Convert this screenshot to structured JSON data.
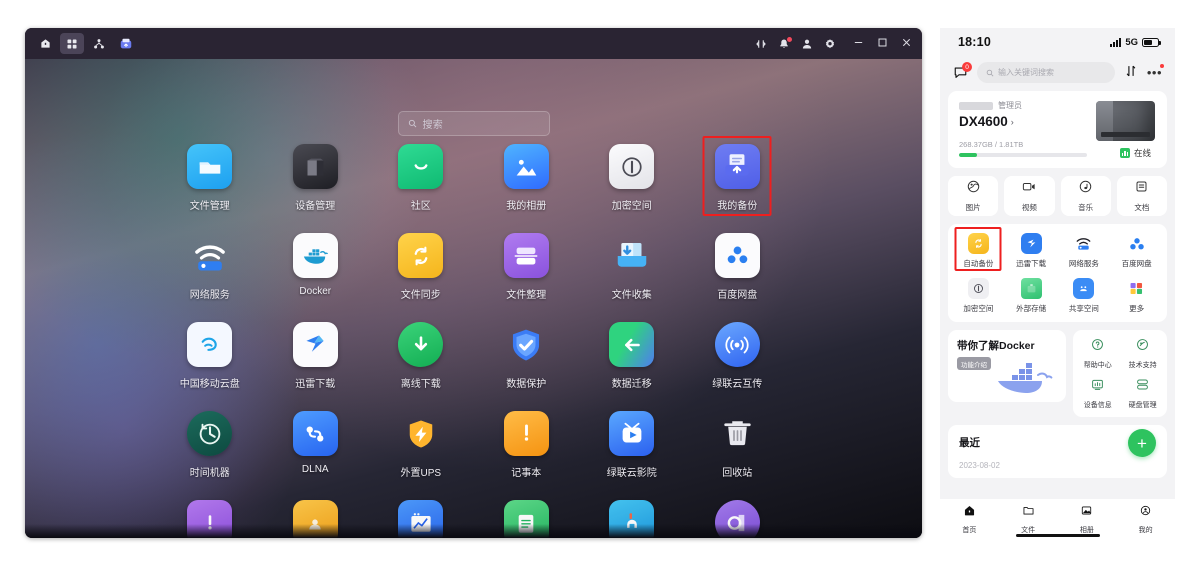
{
  "desktop": {
    "titlebar": {
      "left_icons": [
        "home-icon",
        "apps-grid-icon",
        "sitemap-icon",
        "backup-app-icon"
      ],
      "right_icons": [
        "transfer-icon",
        "notification-bell-icon",
        "user-icon",
        "settings-gear-icon"
      ],
      "window_controls": [
        "minimize",
        "maximize",
        "close"
      ]
    },
    "search": {
      "placeholder": "搜索",
      "icon": "search-icon"
    },
    "selection_color": "#ee1f1f",
    "apps": [
      {
        "label": "文件管理",
        "icon": "folder-blue-icon",
        "selected": false
      },
      {
        "label": "设备管理",
        "icon": "nas-device-icon",
        "selected": false
      },
      {
        "label": "社区",
        "icon": "community-smile-icon",
        "selected": false
      },
      {
        "label": "我的相册",
        "icon": "photo-album-icon",
        "selected": false
      },
      {
        "label": "加密空间",
        "icon": "encrypted-space-icon",
        "selected": false
      },
      {
        "label": "我的备份",
        "icon": "my-backup-icon",
        "selected": true
      },
      {
        "label": "网络服务",
        "icon": "network-service-icon",
        "selected": false
      },
      {
        "label": "Docker",
        "icon": "docker-whale-icon",
        "selected": false
      },
      {
        "label": "文件同步",
        "icon": "file-sync-icon",
        "selected": false
      },
      {
        "label": "文件整理",
        "icon": "file-organize-icon",
        "selected": false
      },
      {
        "label": "文件收集",
        "icon": "file-collect-icon",
        "selected": false
      },
      {
        "label": "百度网盘",
        "icon": "baidu-netdisk-icon",
        "selected": false
      },
      {
        "label": "中国移动云盘",
        "icon": "cmcc-cloud-icon",
        "selected": false
      },
      {
        "label": "迅雷下载",
        "icon": "thunder-download-icon",
        "selected": false
      },
      {
        "label": "离线下载",
        "icon": "offline-download-icon",
        "selected": false
      },
      {
        "label": "数据保护",
        "icon": "data-protection-shield-icon",
        "selected": false
      },
      {
        "label": "数据迁移",
        "icon": "data-migration-icon",
        "selected": false
      },
      {
        "label": "绿联云互传",
        "icon": "ugreen-transfer-icon",
        "selected": false
      },
      {
        "label": "时间机器",
        "icon": "time-machine-icon",
        "selected": false
      },
      {
        "label": "DLNA",
        "icon": "dlna-icon",
        "selected": false
      },
      {
        "label": "外置UPS",
        "icon": "external-ups-icon",
        "selected": false
      },
      {
        "label": "记事本",
        "icon": "notepad-icon",
        "selected": false
      },
      {
        "label": "绿联云影院",
        "icon": "ugreen-cinema-icon",
        "selected": false
      },
      {
        "label": "回收站",
        "icon": "recycle-bin-icon",
        "selected": false
      }
    ],
    "apps_partial_row": [
      {
        "label": "",
        "icon": "alert-purple-icon"
      },
      {
        "label": "",
        "icon": "user-folder-yellow-icon"
      },
      {
        "label": "",
        "icon": "monitor-chart-icon"
      },
      {
        "label": "",
        "icon": "clipboard-green-icon"
      },
      {
        "label": "",
        "icon": "audiobook-icon"
      },
      {
        "label": "",
        "icon": "purple-media-icon"
      }
    ]
  },
  "phone": {
    "status": {
      "time": "18:10",
      "network": "5G",
      "signal_icon": "signal-bars-icon",
      "battery_icon": "battery-icon"
    },
    "topbar": {
      "chat_icon": "chat-bubble-icon",
      "chat_badge": "0",
      "search_placeholder": "输入关键词搜索",
      "transfer_icon": "transfer-arrows-icon",
      "more_icon": "more-dots-icon"
    },
    "device": {
      "role": "管理员",
      "name": "DX4600",
      "chevron": "›",
      "capacity": "268.37GB / 1.81TB",
      "used_percent": 14,
      "status": "在线",
      "status_color": "#2ec35f",
      "device_image": "nas-device-photo"
    },
    "media": [
      {
        "label": "图片",
        "icon": "picture-icon"
      },
      {
        "label": "视频",
        "icon": "video-icon"
      },
      {
        "label": "音乐",
        "icon": "music-icon"
      },
      {
        "label": "文档",
        "icon": "document-icon"
      }
    ],
    "shortcuts": [
      {
        "label": "自动备份",
        "icon": "auto-backup-icon",
        "selected": true
      },
      {
        "label": "迅雷下载",
        "icon": "thunder-download-icon",
        "selected": false
      },
      {
        "label": "网络服务",
        "icon": "network-service-icon",
        "selected": false
      },
      {
        "label": "百度网盘",
        "icon": "baidu-netdisk-icon",
        "selected": false
      },
      {
        "label": "加密空间",
        "icon": "encrypted-space-icon",
        "selected": false
      },
      {
        "label": "外部存储",
        "icon": "external-storage-icon",
        "selected": false
      },
      {
        "label": "共享空间",
        "icon": "shared-space-icon",
        "selected": false
      },
      {
        "label": "更多",
        "icon": "more-apps-icon",
        "selected": false
      }
    ],
    "banner": {
      "title": "带你了解Docker",
      "tag": "功能介绍",
      "image": "docker-whale-illustration"
    },
    "tools": [
      {
        "label": "帮助中心",
        "icon": "help-circle-icon"
      },
      {
        "label": "技术支持",
        "icon": "tech-support-icon"
      },
      {
        "label": "设备信息",
        "icon": "device-info-icon"
      },
      {
        "label": "硬盘管理",
        "icon": "disk-management-icon"
      }
    ],
    "recent": {
      "title": "最近",
      "date": "2023-08-02",
      "add_label": "+"
    },
    "tabs": [
      {
        "label": "首页",
        "icon": "home-icon",
        "active": true
      },
      {
        "label": "文件",
        "icon": "folder-icon",
        "active": false
      },
      {
        "label": "相册",
        "icon": "album-icon",
        "active": false
      },
      {
        "label": "我的",
        "icon": "profile-icon",
        "active": false
      }
    ]
  }
}
